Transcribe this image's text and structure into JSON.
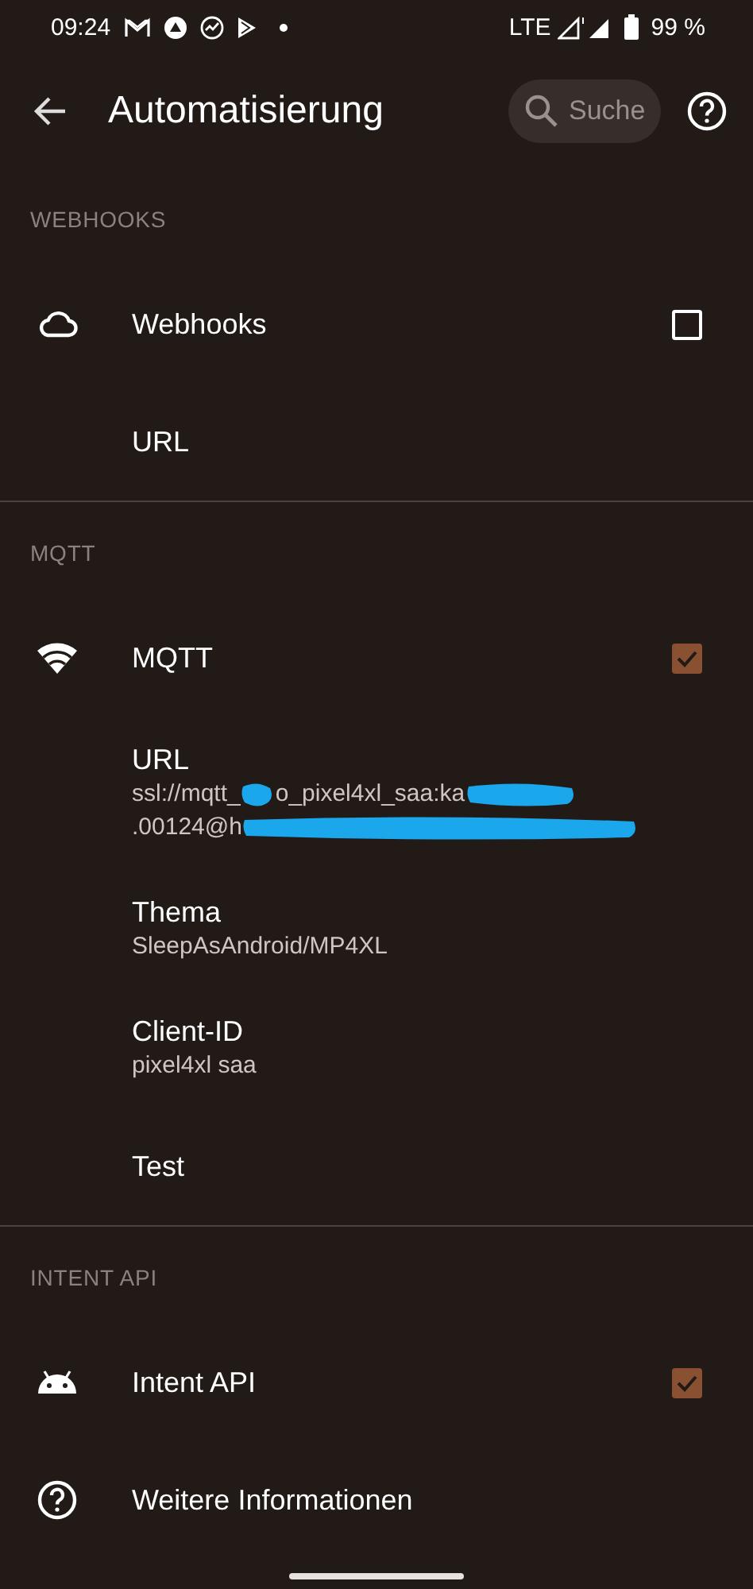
{
  "status_bar": {
    "time": "09:24",
    "network": "LTE",
    "battery": "99 %"
  },
  "toolbar": {
    "title": "Automatisierung",
    "search": {
      "placeholder": "Suche"
    }
  },
  "sections": [
    {
      "header": "WEBHOOKS",
      "items": [
        {
          "kind": "checkbox",
          "title": "Webhooks",
          "checked": false
        },
        {
          "kind": "text",
          "title": "URL"
        }
      ]
    },
    {
      "header": "MQTT",
      "items": [
        {
          "kind": "checkbox",
          "title": "MQTT",
          "checked": true
        },
        {
          "kind": "text",
          "title": "URL",
          "summary_lines": [
            [
              "ssl://mqtt_",
              "o_pixel4xl_saa:ka"
            ],
            [
              ".00124@h"
            ]
          ],
          "redacted": true
        },
        {
          "kind": "text",
          "title": "Thema",
          "summary_lines": [
            [
              "SleepAsAndroid/MP4XL"
            ]
          ]
        },
        {
          "kind": "text",
          "title": "Client-ID",
          "summary_lines": [
            [
              "pixel4xl saa"
            ]
          ]
        },
        {
          "kind": "text",
          "title": "Test"
        }
      ]
    },
    {
      "header": "INTENT API",
      "items": [
        {
          "kind": "checkbox",
          "title": "Intent API",
          "checked": true
        },
        {
          "kind": "text",
          "title": "Weitere Informationen"
        }
      ]
    }
  ]
}
